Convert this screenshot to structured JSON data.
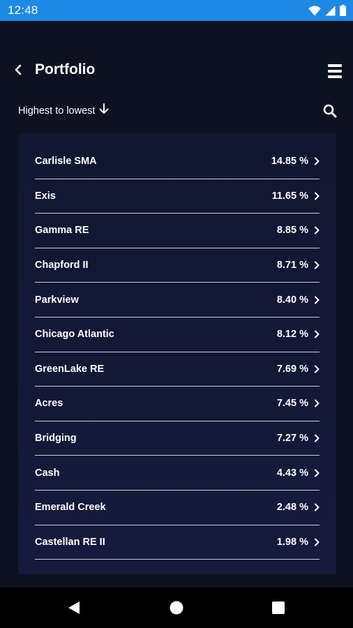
{
  "status_bar": {
    "time": "12:48",
    "icons": [
      "wifi-icon",
      "signal-icon",
      "battery-icon"
    ]
  },
  "header": {
    "title": "Portfolio",
    "back_icon": "chevron-left-icon",
    "menu_icon": "menu-icon"
  },
  "sort": {
    "label": "Highest to lowest",
    "icon": "arrow-down-icon"
  },
  "search": {
    "icon": "search-icon"
  },
  "holdings": [
    {
      "name": "Carlisle SMA",
      "value": "14.85 %"
    },
    {
      "name": "Exis",
      "value": "11.65 %"
    },
    {
      "name": "Gamma RE",
      "value": "8.85 %"
    },
    {
      "name": "Chapford II",
      "value": "8.71 %"
    },
    {
      "name": "Parkview",
      "value": "8.40 %"
    },
    {
      "name": "Chicago Atlantic",
      "value": "8.12 %"
    },
    {
      "name": "GreenLake RE",
      "value": "7.69 %"
    },
    {
      "name": "Acres",
      "value": "7.45 %"
    },
    {
      "name": "Bridging",
      "value": "7.27 %"
    },
    {
      "name": "Cash",
      "value": "4.43 %"
    },
    {
      "name": "Emerald Creek",
      "value": "2.48 %"
    },
    {
      "name": "Castellan RE II",
      "value": "1.98 %"
    }
  ],
  "colors": {
    "status_bar": "#1e88e5",
    "background": "#0c1220",
    "card_top": "#101730",
    "card_bottom": "#141b3d",
    "divider": "#c9ced8",
    "text": "#ffffff"
  },
  "nav_bar": {
    "icons": [
      "nav-back-icon",
      "nav-home-icon",
      "nav-recents-icon"
    ]
  }
}
